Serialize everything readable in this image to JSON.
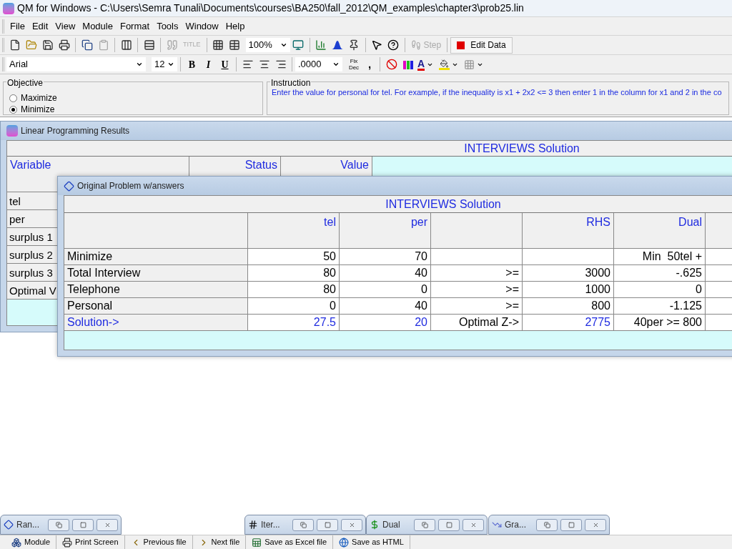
{
  "window": {
    "title": "QM for Windows - C:\\Users\\Semra Tunali\\Documents\\courses\\BA250\\fall_2012\\QM_examples\\chapter3\\prob25.lin"
  },
  "menu": [
    "File",
    "Edit",
    "View",
    "Module",
    "Format",
    "Tools",
    "Window",
    "Help"
  ],
  "toolbar": {
    "title_tool": {
      "label": "TITLE",
      "disabled": true
    },
    "zoom": "100%",
    "step": {
      "label": "Step",
      "disabled": true
    },
    "edit_data": "Edit Data"
  },
  "format_bar": {
    "font": "Arial",
    "size": "12",
    "bold": "B",
    "italic": "I",
    "underline": "U",
    "number_format": ".0000",
    "fix_dec": "Fix Dec",
    "comma": ",",
    "font_color": "A"
  },
  "objective": {
    "label": "Objective",
    "options": [
      {
        "label": "Maximize",
        "selected": false
      },
      {
        "label": "Minimize",
        "selected": true
      }
    ]
  },
  "instruction": {
    "label": "Instruction",
    "text": "Enter the value for personal for tel. For example, if the inequality is x1 + 2x2 <= 3 then enter 1 in the column for x1 and 2 in the co"
  },
  "results_window": {
    "title": "Linear Programming Results",
    "heading": "INTERVIEWS Solution",
    "columns": [
      "Variable",
      "Status",
      "Value"
    ],
    "rows": [
      "tel",
      "per",
      "surplus 1",
      "surplus 2",
      "surplus 3",
      "Optimal V"
    ]
  },
  "problem_window": {
    "title": "Original Problem w/answers",
    "heading": "INTERVIEWS Solution",
    "columns": [
      "tel",
      "per",
      null,
      "RHS",
      "Dual"
    ],
    "rows": [
      {
        "kind": "data",
        "label": "Minimize",
        "cells": [
          "50",
          "70",
          null,
          null,
          "Min  50tel +"
        ]
      },
      {
        "kind": "data",
        "label": "Total Interview",
        "cells": [
          "80",
          "40",
          ">=",
          "3000",
          "-.625"
        ]
      },
      {
        "kind": "data",
        "label": "Telephone",
        "cells": [
          "80",
          "0",
          ">=",
          "1000",
          "0"
        ]
      },
      {
        "kind": "data",
        "label": "Personal",
        "cells": [
          "0",
          "40",
          ">=",
          "800",
          "-1.125"
        ]
      },
      {
        "kind": "solution",
        "label": "Solution->",
        "cells": [
          {
            "text": "27.5",
            "emphasis": true
          },
          {
            "text": "20",
            "emphasis": true
          },
          {
            "text": "Optimal Z->",
            "emphasis": false
          },
          {
            "text": "2775",
            "emphasis": true
          },
          {
            "text": "40per >= 800",
            "emphasis": false
          }
        ]
      }
    ]
  },
  "minimized_windows": [
    {
      "kind": "ranging",
      "title": "Ran..."
    },
    {
      "kind": "iterations",
      "title": "Iter..."
    },
    {
      "kind": "dual",
      "title": "Dual"
    },
    {
      "kind": "graph",
      "title": "Gra..."
    }
  ],
  "bottom_toolbar": [
    {
      "kind": "module",
      "label": "Module"
    },
    {
      "kind": "print",
      "label": "Print Screen"
    },
    {
      "kind": "previous",
      "label": "Previous file"
    },
    {
      "kind": "next",
      "label": "Next file"
    },
    {
      "kind": "excel",
      "label": "Save as Excel file"
    },
    {
      "kind": "html",
      "label": "Save as HTML"
    }
  ]
}
